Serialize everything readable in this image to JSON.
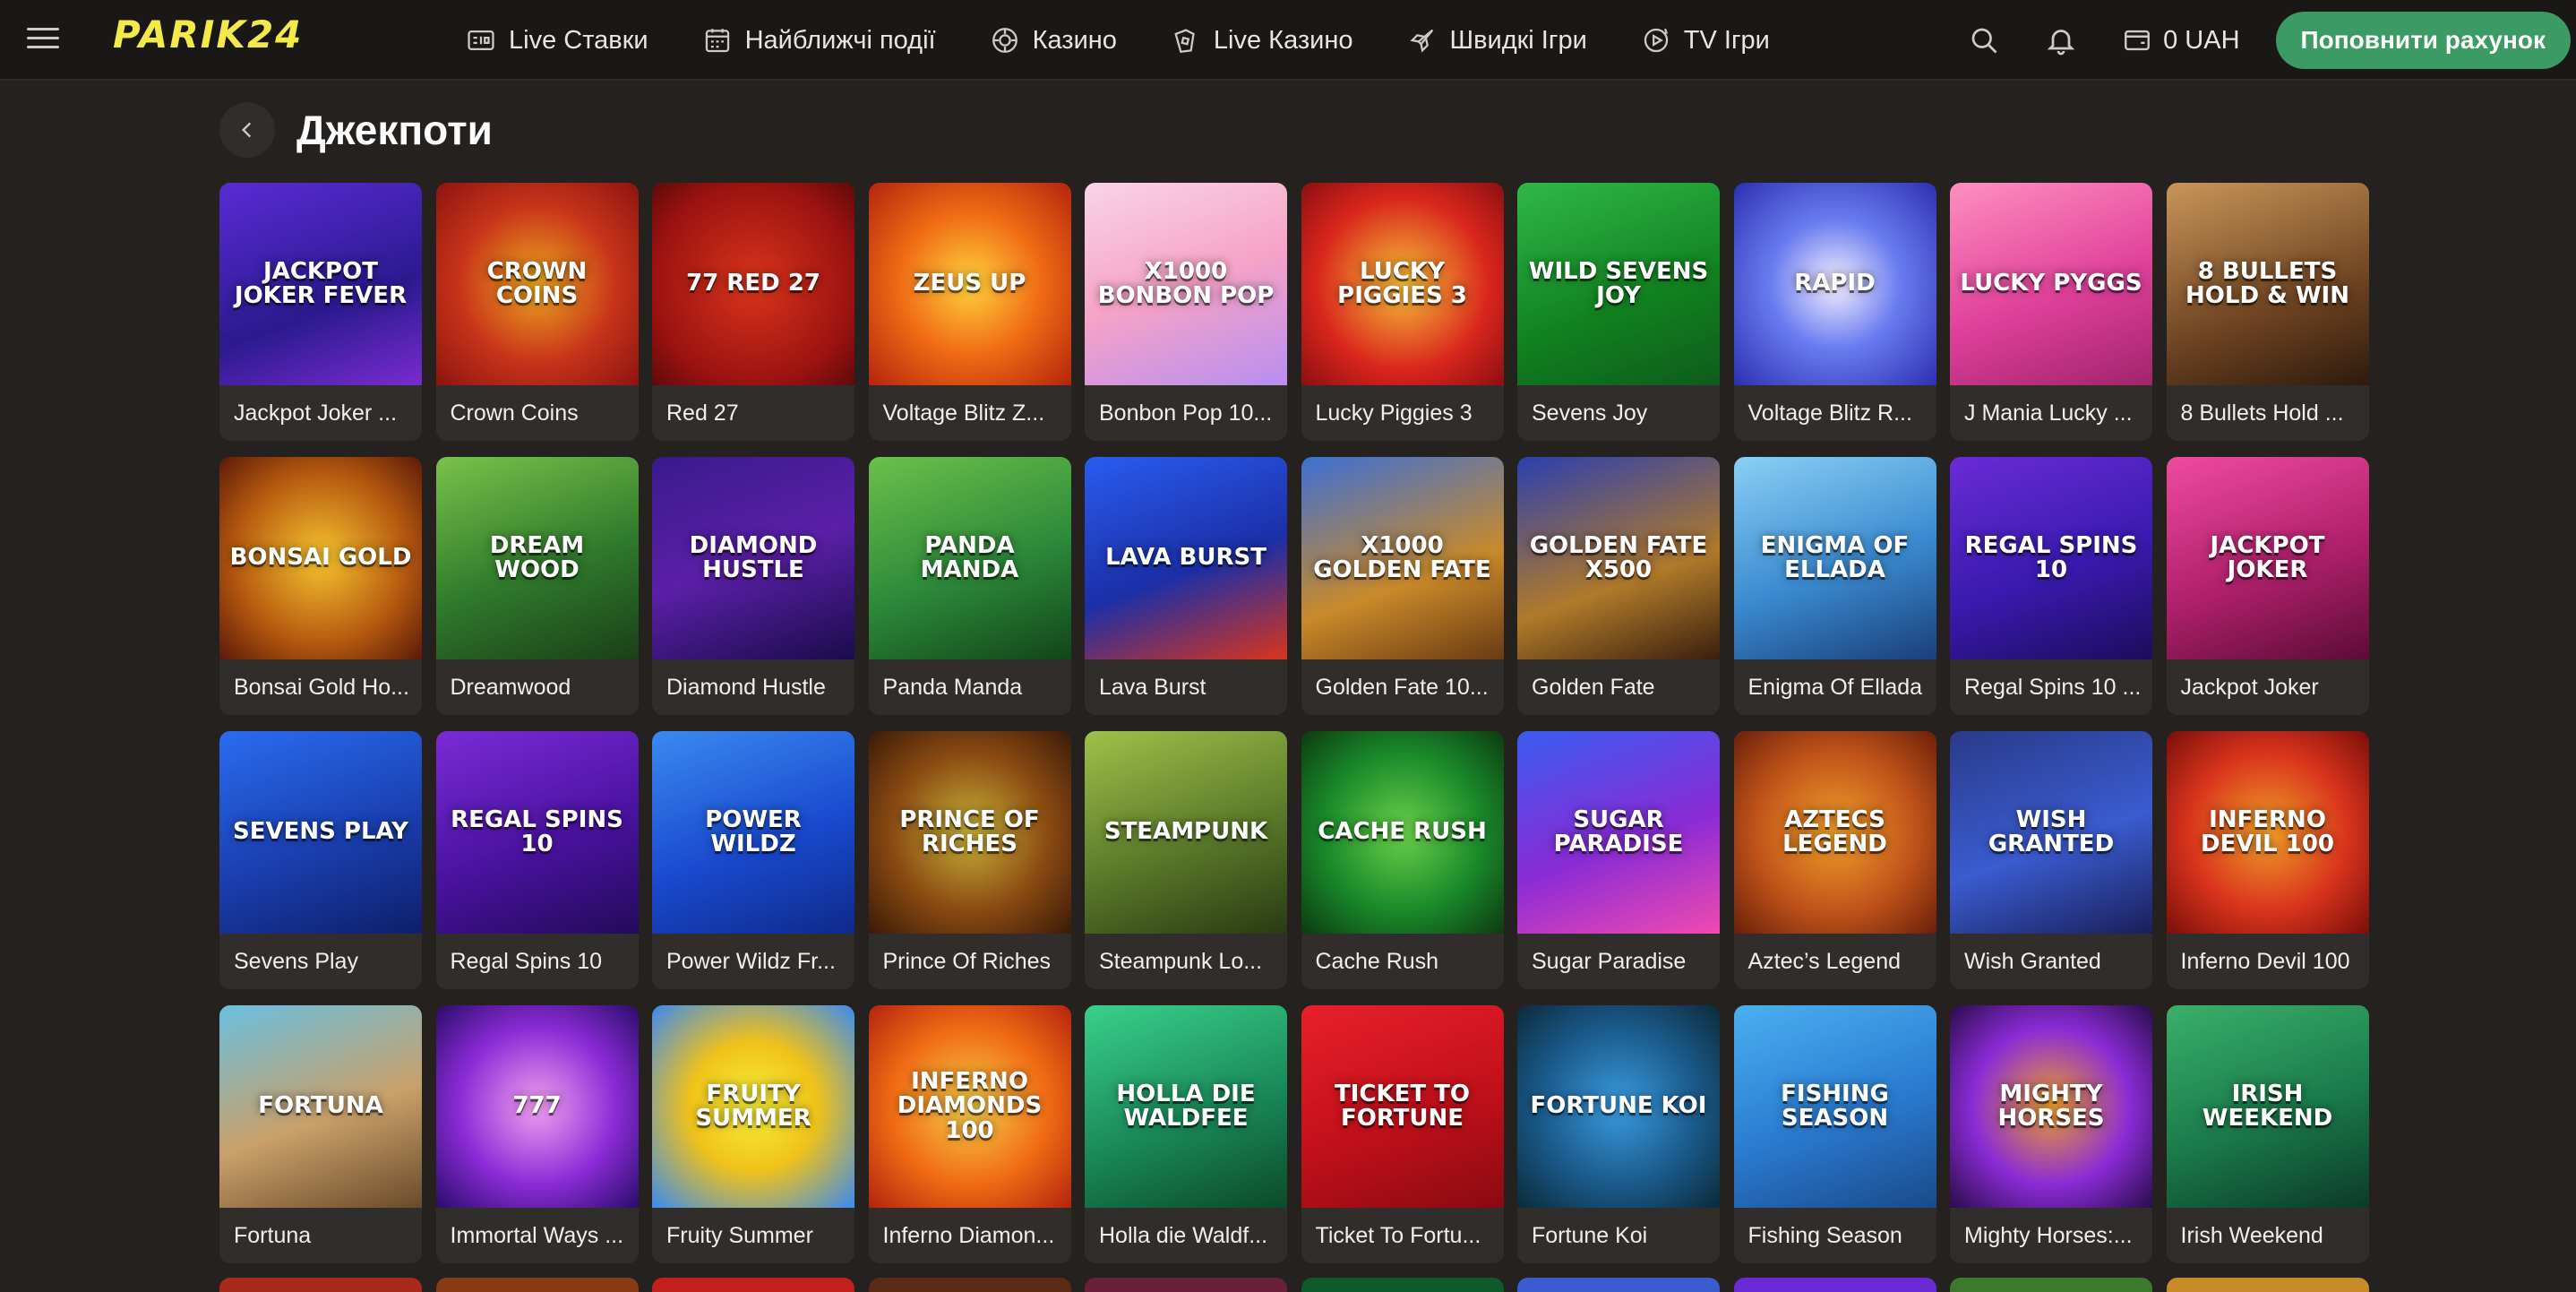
{
  "brand": {
    "logo_text": "PARIK24"
  },
  "nav": [
    {
      "label": "Live Ставки",
      "icon": "live-bets-icon"
    },
    {
      "label": "Найближчі події",
      "icon": "calendar-icon"
    },
    {
      "label": "Казино",
      "icon": "casino-chip-icon"
    },
    {
      "label": "Live Казино",
      "icon": "live-casino-icon"
    },
    {
      "label": "Швидкі Ігри",
      "icon": "rocket-icon"
    },
    {
      "label": "TV Ігри",
      "icon": "tv-games-icon"
    }
  ],
  "header": {
    "balance": "0 UAH",
    "deposit_label": "Поповнити рахунок"
  },
  "page": {
    "title": "Джекпоти"
  },
  "colors": {
    "accent": "#3c9a64",
    "logo": "#f3e94a",
    "background": "#24211f",
    "tile": "#302d2a"
  },
  "games": [
    {
      "name": "Jackpot Joker ...",
      "art": "Jackpot Joker Fever",
      "bg": "linear-gradient(160deg,#5a2bd6,#2b1a8f 60%,#7a2bd0)"
    },
    {
      "name": "Crown Coins",
      "art": "Crown Coins",
      "bg": "radial-gradient(circle,#f0a820 0%,#c7331a 55%,#8c1410 100%)"
    },
    {
      "name": "Red 27",
      "art": "77 Red 27",
      "bg": "radial-gradient(circle,#d9341c 0%,#9b1210 70%,#5e0a0a 100%)"
    },
    {
      "name": "Voltage Blitz Z...",
      "art": "Zeus Up",
      "bg": "radial-gradient(circle,#ffd23c 0%,#f06a14 50%,#b4230e 100%)"
    },
    {
      "name": "Bonbon Pop 10...",
      "art": "x1000 Bonbon Pop",
      "bg": "linear-gradient(160deg,#f9d4e6,#f6a3c7 50%,#b88ef0)"
    },
    {
      "name": "Lucky Piggies 3",
      "art": "Lucky Piggies 3",
      "bg": "radial-gradient(circle,#f7c33a 0%,#d9261c 60%,#8c0e12 100%)"
    },
    {
      "name": "Sevens Joy",
      "art": "Wild Sevens Joy",
      "bg": "linear-gradient(160deg,#2fb84a,#11801f 60%,#0e5c1b)"
    },
    {
      "name": "Voltage Blitz R...",
      "art": "Rapid",
      "bg": "radial-gradient(circle,#f5f0ff 0%,#6a7cf0 45%,#2c2fb0 100%)"
    },
    {
      "name": "J Mania Lucky ...",
      "art": "Lucky Pyggs",
      "bg": "linear-gradient(160deg,#ff8fc0,#e0409a 55%,#a0246c)"
    },
    {
      "name": "8 Bullets Hold ...",
      "art": "8 Bullets Hold & Win",
      "bg": "linear-gradient(160deg,#c99559,#6f4422 60%,#2e1a0d)"
    },
    {
      "name": "Bonsai Gold Ho...",
      "art": "Bonsai Gold",
      "bg": "radial-gradient(circle,#f7c430 0%,#b4580f 60%,#5a1a08 100%)"
    },
    {
      "name": "Dreamwood",
      "art": "Dream Wood",
      "bg": "linear-gradient(160deg,#79c24a,#2f7a2c 55%,#1b3f18)"
    },
    {
      "name": "Diamond Hustle",
      "art": "Diamond Hustle",
      "bg": "linear-gradient(160deg,#3a1a8c,#5b1fa8 50%,#1a0c4a)"
    },
    {
      "name": "Panda Manda",
      "art": "Panda Manda",
      "bg": "linear-gradient(160deg,#6cc04a,#2d8a3a 55%,#12451a)"
    },
    {
      "name": "Lava Burst",
      "art": "Lava Burst",
      "bg": "linear-gradient(160deg,#2a5cf0,#1b2fa8 55%,#d9341c)"
    },
    {
      "name": "Golden Fate 10...",
      "art": "x1000 Golden Fate",
      "bg": "linear-gradient(160deg,#3d6fd6,#c98a2a 60%,#6a3a12)"
    },
    {
      "name": "Golden Fate",
      "art": "Golden Fate x500",
      "bg": "linear-gradient(160deg,#2c3fb0,#b07a2a 60%,#3a1f0e)"
    },
    {
      "name": "Enigma Of Ellada",
      "art": "Enigma of Ellada",
      "bg": "linear-gradient(160deg,#8ad0f5,#3a8ad0 55%,#1a3f7a)"
    },
    {
      "name": "Regal Spins 10 ...",
      "art": "Regal Spins 10",
      "bg": "linear-gradient(160deg,#6a2bd6,#3a1ab0 55%,#1c0c5c)"
    },
    {
      "name": "Jackpot Joker",
      "art": "Jackpot Joker",
      "bg": "linear-gradient(160deg,#f04aa0,#b0206c 55%,#5c0c38)"
    },
    {
      "name": "Sevens Play",
      "art": "Sevens Play",
      "bg": "linear-gradient(160deg,#2a6cf0,#1a3fb0 55%,#0e1f6a)"
    },
    {
      "name": "Regal Spins 10",
      "art": "Regal Spins 10",
      "bg": "linear-gradient(160deg,#7a2bd6,#4a12a0 55%,#240a5a)"
    },
    {
      "name": "Power Wildz Fr...",
      "art": "Power Wildz",
      "bg": "linear-gradient(160deg,#3a8af0,#1a4ad0 55%,#0e2a8a)"
    },
    {
      "name": "Prince Of Riches",
      "art": "Prince of Riches",
      "bg": "radial-gradient(circle,#c9b43a 0%,#8a4a12 55%,#3a1a08 100%)"
    },
    {
      "name": "Steampunk Lo...",
      "art": "Steampunk",
      "bg": "linear-gradient(160deg,#a0c04a,#5a7a2a 55%,#2a3a12)"
    },
    {
      "name": "Cache Rush",
      "art": "Cache Rush",
      "bg": "radial-gradient(circle,#6ad04a 0%,#1a8a2a 55%,#0c3a12 100%)"
    },
    {
      "name": "Sugar Paradise",
      "art": "Sugar Paradise",
      "bg": "linear-gradient(160deg,#3a5cf0,#8a2bd6 55%,#f04ab0)"
    },
    {
      "name": "Aztec’s Legend",
      "art": "Aztecs Legend",
      "bg": "radial-gradient(circle,#f0a02a 0%,#c2541a 55%,#6a1f0a 100%)"
    },
    {
      "name": "Wish Granted",
      "art": "Wish Granted",
      "bg": "linear-gradient(160deg,#2a3a8a,#3a5cd0 55%,#1a1f5a)"
    },
    {
      "name": "Inferno Devil 100",
      "art": "Inferno Devil 100",
      "bg": "radial-gradient(circle,#f0a02a 0%,#d9341c 55%,#7a0e0a 100%)"
    },
    {
      "name": "Fortuna",
      "art": "Fortuna",
      "bg": "linear-gradient(160deg,#6ac0e0,#c9a06a 55%,#6a4a2a)"
    },
    {
      "name": "Immortal Ways ...",
      "art": "777",
      "bg": "radial-gradient(circle,#f0a0f0 0%,#8a2bd6 55%,#2a0c6a 100%)"
    },
    {
      "name": "Fruity Summer",
      "art": "Fruity Summer",
      "bg": "radial-gradient(circle,#f7f03a 0%,#f0c21a 45%,#3a8af0 100%)"
    },
    {
      "name": "Inferno Diamon...",
      "art": "Inferno Diamonds 100",
      "bg": "radial-gradient(circle,#f7d04a 0%,#f06a14 55%,#b4230e 100%)"
    },
    {
      "name": "Holla die Waldf...",
      "art": "Holla die Waldfee",
      "bg": "linear-gradient(160deg,#3ad08a,#1a8a5a 55%,#0c4a2a)"
    },
    {
      "name": "Ticket To Fortu...",
      "art": "Ticket to Fortune",
      "bg": "linear-gradient(160deg,#e8202a,#c2101a 55%,#8a0a12)"
    },
    {
      "name": "Fortune Koi",
      "art": "Fortune Koi",
      "bg": "radial-gradient(circle,#3a9ae0 0%,#1a5a8a 55%,#0c2a3a 100%)"
    },
    {
      "name": "Fishing Season",
      "art": "Fishing Season",
      "bg": "linear-gradient(160deg,#4ab0f0,#2a7ad0 55%,#1a4a8a)"
    },
    {
      "name": "Mighty Horses:...",
      "art": "Mighty Horses",
      "bg": "radial-gradient(circle,#f0a02a 0%,#8a2bd6 55%,#2a0c4a 100%)"
    },
    {
      "name": "Irish Weekend",
      "art": "Irish Weekend",
      "bg": "linear-gradient(160deg,#3ab06a,#1a7a4a 55%,#0c3a2a)"
    }
  ],
  "next_row_colors": [
    "#a82a1a",
    "#8a3a14",
    "#c2201a",
    "#5a2a12",
    "#6a1f3a",
    "#0e5a2a",
    "#3a5cd0",
    "#6a2bd6",
    "#3a7a2a",
    "#c98a2a"
  ]
}
